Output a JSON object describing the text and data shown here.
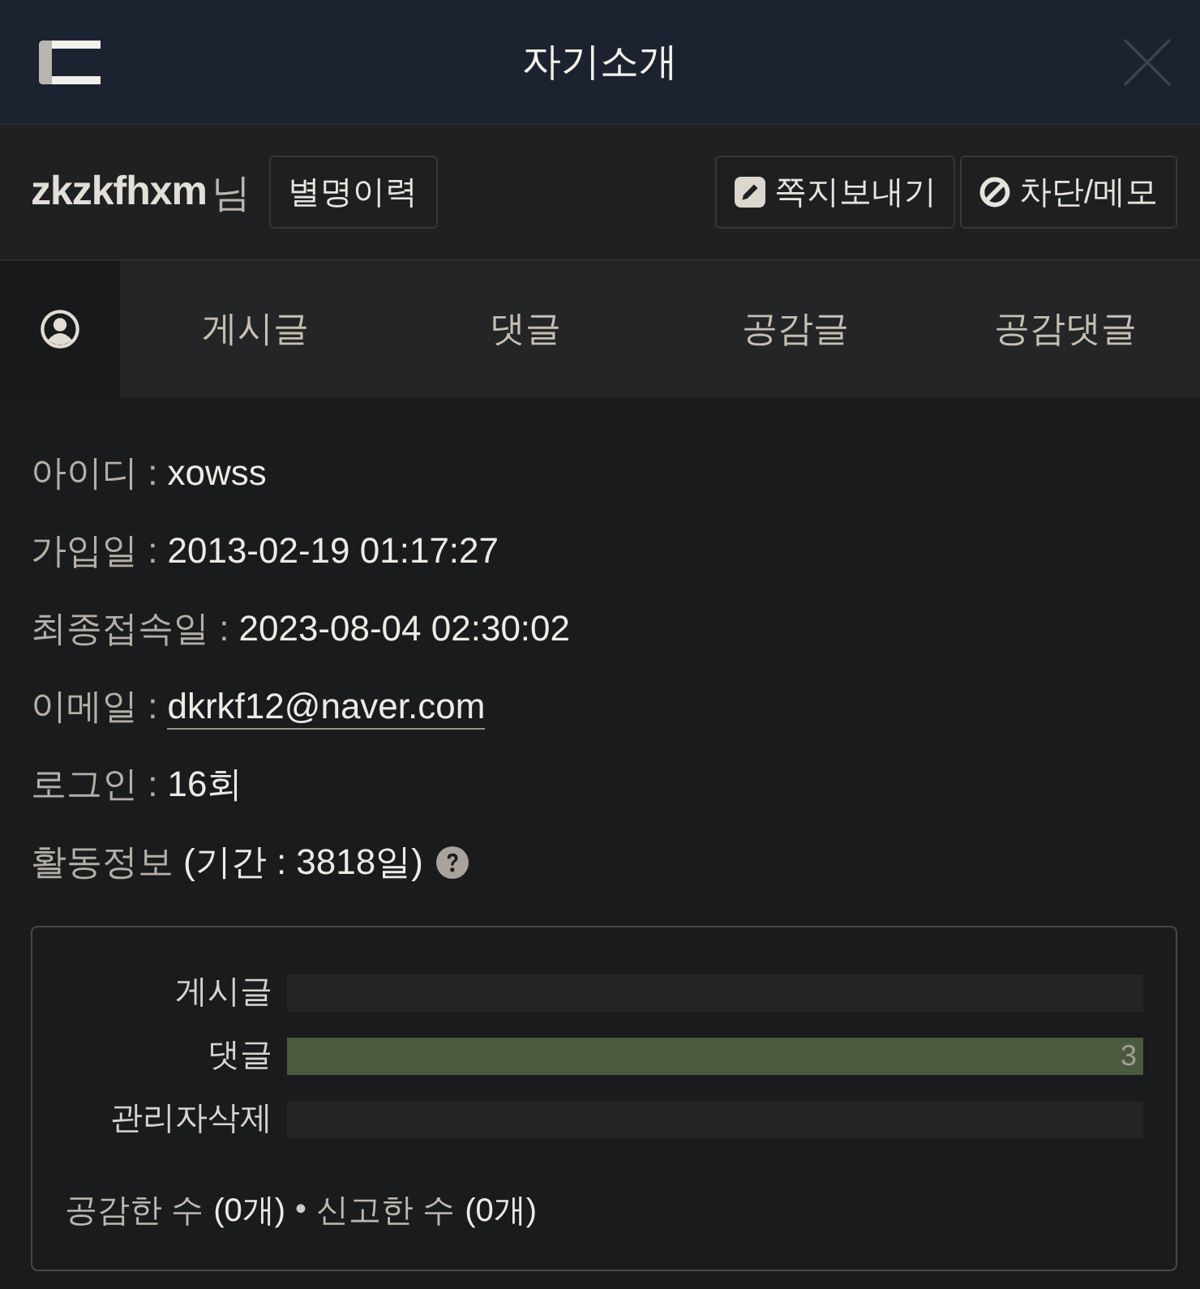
{
  "header": {
    "title": "자기소개"
  },
  "user": {
    "nickname": "zkzkfhxm",
    "suffix": "님",
    "history_button": "별명이력",
    "actions": [
      {
        "kind": "message",
        "label": "쪽지보내기"
      },
      {
        "kind": "block",
        "label": "차단/메모"
      }
    ]
  },
  "tabs": [
    {
      "kind": "profile",
      "selected": true
    },
    {
      "kind": "text",
      "label": "게시글",
      "selected": false
    },
    {
      "kind": "text",
      "label": "댓글",
      "selected": false
    },
    {
      "kind": "text",
      "label": "공감글",
      "selected": false
    },
    {
      "kind": "text",
      "label": "공감댓글",
      "selected": false
    }
  ],
  "info": [
    {
      "kind": "text",
      "label": "아이디 :",
      "value": "xowss"
    },
    {
      "kind": "text",
      "label": "가입일 :",
      "value": "2013-02-19 01:17:27"
    },
    {
      "kind": "text",
      "label": "최종접속일 :",
      "value": "2023-08-04 02:30:02"
    },
    {
      "kind": "link",
      "label": "이메일 :",
      "value": "dkrkf12@naver.com"
    },
    {
      "kind": "text",
      "label": "로그인 :",
      "value": "16회"
    }
  ],
  "activity": {
    "label": "활동정보",
    "period": "(기간 : 3818일)",
    "bars": [
      {
        "label": "게시글",
        "level": 0
      },
      {
        "label": "댓글",
        "level": 1,
        "reading": "3"
      },
      {
        "label": "관리자삭제",
        "level": 0
      }
    ],
    "stats": [
      {
        "label": "공감한 수",
        "value": "(0개)"
      },
      {
        "label": "신고한 수",
        "value": "(0개)"
      }
    ],
    "separator": "•"
  }
}
